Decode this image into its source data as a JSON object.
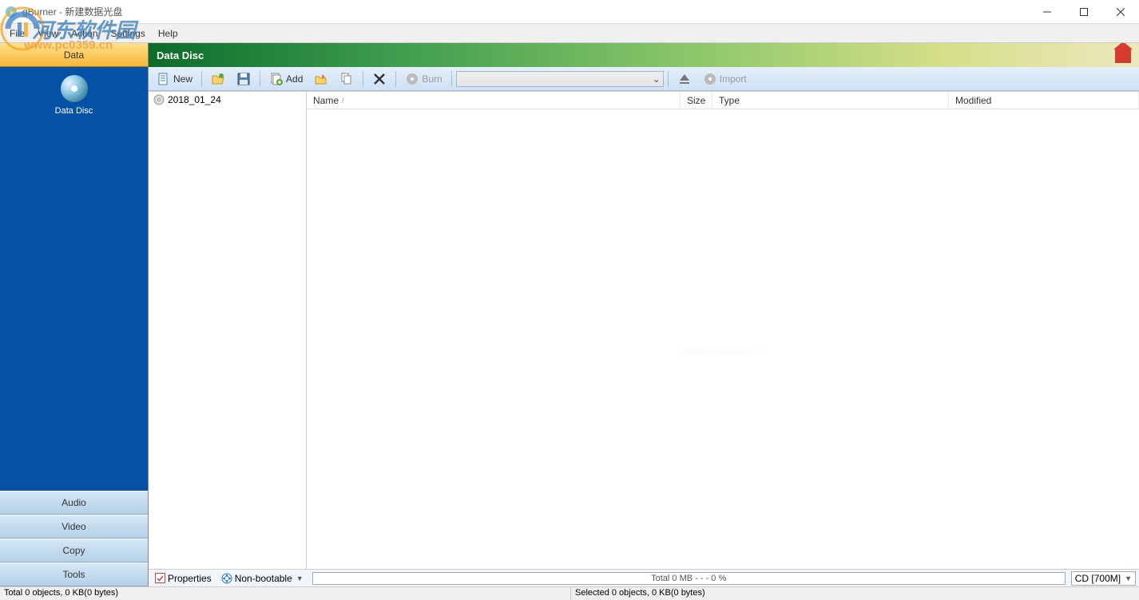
{
  "window": {
    "title": "gBurner - 新建数据光盘"
  },
  "menu": {
    "file": "File",
    "view": "View",
    "action": "Action",
    "settings": "Settings",
    "help": "Help"
  },
  "sidebar": {
    "data": "Data",
    "data_disc": "Data Disc",
    "audio": "Audio",
    "video": "Video",
    "copy": "Copy",
    "tools": "Tools"
  },
  "header": {
    "title": "Data Disc"
  },
  "toolbar": {
    "new": "New",
    "add": "Add",
    "burn": "Burn",
    "import": "Import"
  },
  "tree": {
    "root": "2018_01_24"
  },
  "columns": {
    "name": "Name",
    "size": "Size",
    "type": "Type",
    "modified": "Modified"
  },
  "footer": {
    "properties": "Properties",
    "bootable": "Non-bootable",
    "progress": "Total  0 MB   - - -  0 %",
    "disc": "CD [700M]"
  },
  "status": {
    "left": "Total 0 objects, 0 KB(0 bytes)",
    "right": "Selected 0 objects, 0 KB(0 bytes)"
  },
  "watermark": {
    "cn": "河东软件园",
    "url": "www.pc0359.cn"
  }
}
